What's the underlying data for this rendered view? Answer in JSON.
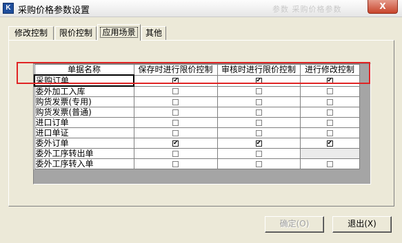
{
  "window": {
    "title": "采购价格参数设置",
    "title_faded": "  参数  采购价格参数",
    "close_label": "X"
  },
  "tabs": [
    {
      "label": "修改控制"
    },
    {
      "label": "限价控制"
    },
    {
      "label": "应用场景"
    },
    {
      "label": "其他"
    }
  ],
  "table": {
    "headers": [
      "单据名称",
      "保存时进行限价控制",
      "审核时进行限价控制",
      "进行修改控制"
    ],
    "rows": [
      {
        "name": "采购订单",
        "save": true,
        "audit": true,
        "modify": true
      },
      {
        "name": "委外加工入库",
        "save": false,
        "audit": false,
        "modify": false
      },
      {
        "name": "购货发票(专用)",
        "save": false,
        "audit": false,
        "modify": false
      },
      {
        "name": "购货发票(普通)",
        "save": false,
        "audit": false,
        "modify": false
      },
      {
        "name": "进口订单",
        "save": false,
        "audit": false,
        "modify": false
      },
      {
        "name": "进口单证",
        "save": false,
        "audit": false,
        "modify": false
      },
      {
        "name": "委外订单",
        "save": true,
        "audit": true,
        "modify": true
      },
      {
        "name": "委外工序转出单",
        "save": false,
        "audit": false,
        "modify": null
      },
      {
        "name": "委外工序转入单",
        "save": false,
        "audit": false,
        "modify": false
      }
    ]
  },
  "buttons": {
    "ok_label": "确定(O)",
    "exit_label": "退出(X)"
  },
  "colors": {
    "highlight": "#e02424",
    "grid_bg": "#a5a5a5",
    "window_bg": "#ece9d8"
  }
}
